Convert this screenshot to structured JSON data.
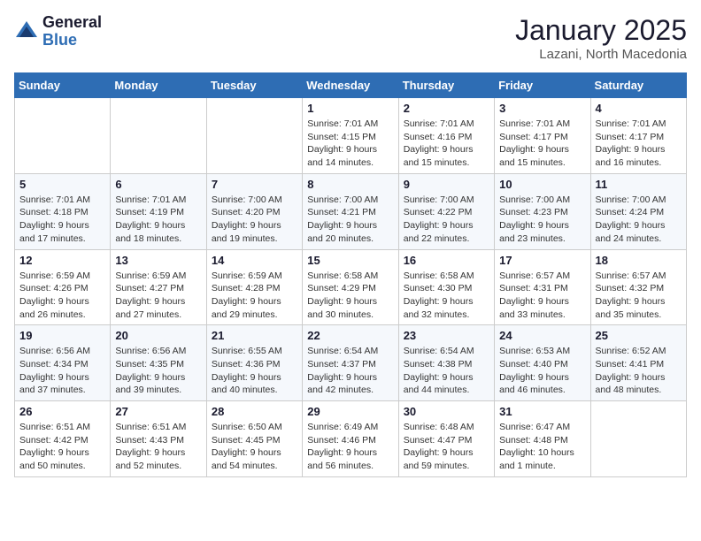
{
  "logo": {
    "general": "General",
    "blue": "Blue"
  },
  "header": {
    "month": "January 2025",
    "location": "Lazani, North Macedonia"
  },
  "weekdays": [
    "Sunday",
    "Monday",
    "Tuesday",
    "Wednesday",
    "Thursday",
    "Friday",
    "Saturday"
  ],
  "weeks": [
    [
      {
        "day": "",
        "info": ""
      },
      {
        "day": "",
        "info": ""
      },
      {
        "day": "",
        "info": ""
      },
      {
        "day": "1",
        "info": "Sunrise: 7:01 AM\nSunset: 4:15 PM\nDaylight: 9 hours and 14 minutes."
      },
      {
        "day": "2",
        "info": "Sunrise: 7:01 AM\nSunset: 4:16 PM\nDaylight: 9 hours and 15 minutes."
      },
      {
        "day": "3",
        "info": "Sunrise: 7:01 AM\nSunset: 4:17 PM\nDaylight: 9 hours and 15 minutes."
      },
      {
        "day": "4",
        "info": "Sunrise: 7:01 AM\nSunset: 4:17 PM\nDaylight: 9 hours and 16 minutes."
      }
    ],
    [
      {
        "day": "5",
        "info": "Sunrise: 7:01 AM\nSunset: 4:18 PM\nDaylight: 9 hours and 17 minutes."
      },
      {
        "day": "6",
        "info": "Sunrise: 7:01 AM\nSunset: 4:19 PM\nDaylight: 9 hours and 18 minutes."
      },
      {
        "day": "7",
        "info": "Sunrise: 7:00 AM\nSunset: 4:20 PM\nDaylight: 9 hours and 19 minutes."
      },
      {
        "day": "8",
        "info": "Sunrise: 7:00 AM\nSunset: 4:21 PM\nDaylight: 9 hours and 20 minutes."
      },
      {
        "day": "9",
        "info": "Sunrise: 7:00 AM\nSunset: 4:22 PM\nDaylight: 9 hours and 22 minutes."
      },
      {
        "day": "10",
        "info": "Sunrise: 7:00 AM\nSunset: 4:23 PM\nDaylight: 9 hours and 23 minutes."
      },
      {
        "day": "11",
        "info": "Sunrise: 7:00 AM\nSunset: 4:24 PM\nDaylight: 9 hours and 24 minutes."
      }
    ],
    [
      {
        "day": "12",
        "info": "Sunrise: 6:59 AM\nSunset: 4:26 PM\nDaylight: 9 hours and 26 minutes."
      },
      {
        "day": "13",
        "info": "Sunrise: 6:59 AM\nSunset: 4:27 PM\nDaylight: 9 hours and 27 minutes."
      },
      {
        "day": "14",
        "info": "Sunrise: 6:59 AM\nSunset: 4:28 PM\nDaylight: 9 hours and 29 minutes."
      },
      {
        "day": "15",
        "info": "Sunrise: 6:58 AM\nSunset: 4:29 PM\nDaylight: 9 hours and 30 minutes."
      },
      {
        "day": "16",
        "info": "Sunrise: 6:58 AM\nSunset: 4:30 PM\nDaylight: 9 hours and 32 minutes."
      },
      {
        "day": "17",
        "info": "Sunrise: 6:57 AM\nSunset: 4:31 PM\nDaylight: 9 hours and 33 minutes."
      },
      {
        "day": "18",
        "info": "Sunrise: 6:57 AM\nSunset: 4:32 PM\nDaylight: 9 hours and 35 minutes."
      }
    ],
    [
      {
        "day": "19",
        "info": "Sunrise: 6:56 AM\nSunset: 4:34 PM\nDaylight: 9 hours and 37 minutes."
      },
      {
        "day": "20",
        "info": "Sunrise: 6:56 AM\nSunset: 4:35 PM\nDaylight: 9 hours and 39 minutes."
      },
      {
        "day": "21",
        "info": "Sunrise: 6:55 AM\nSunset: 4:36 PM\nDaylight: 9 hours and 40 minutes."
      },
      {
        "day": "22",
        "info": "Sunrise: 6:54 AM\nSunset: 4:37 PM\nDaylight: 9 hours and 42 minutes."
      },
      {
        "day": "23",
        "info": "Sunrise: 6:54 AM\nSunset: 4:38 PM\nDaylight: 9 hours and 44 minutes."
      },
      {
        "day": "24",
        "info": "Sunrise: 6:53 AM\nSunset: 4:40 PM\nDaylight: 9 hours and 46 minutes."
      },
      {
        "day": "25",
        "info": "Sunrise: 6:52 AM\nSunset: 4:41 PM\nDaylight: 9 hours and 48 minutes."
      }
    ],
    [
      {
        "day": "26",
        "info": "Sunrise: 6:51 AM\nSunset: 4:42 PM\nDaylight: 9 hours and 50 minutes."
      },
      {
        "day": "27",
        "info": "Sunrise: 6:51 AM\nSunset: 4:43 PM\nDaylight: 9 hours and 52 minutes."
      },
      {
        "day": "28",
        "info": "Sunrise: 6:50 AM\nSunset: 4:45 PM\nDaylight: 9 hours and 54 minutes."
      },
      {
        "day": "29",
        "info": "Sunrise: 6:49 AM\nSunset: 4:46 PM\nDaylight: 9 hours and 56 minutes."
      },
      {
        "day": "30",
        "info": "Sunrise: 6:48 AM\nSunset: 4:47 PM\nDaylight: 9 hours and 59 minutes."
      },
      {
        "day": "31",
        "info": "Sunrise: 6:47 AM\nSunset: 4:48 PM\nDaylight: 10 hours and 1 minute."
      },
      {
        "day": "",
        "info": ""
      }
    ]
  ]
}
